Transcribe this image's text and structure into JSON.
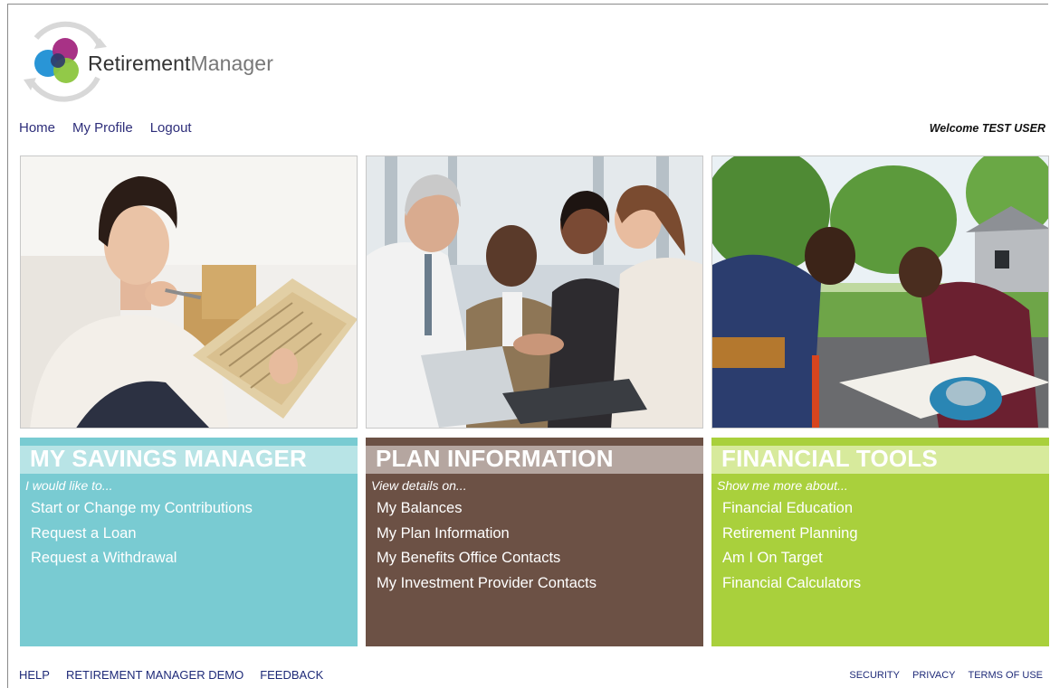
{
  "brand": {
    "name_bold": "Retirement",
    "name_light": "Manager",
    "colors": {
      "teal": "#79cbd2",
      "brown": "#6c5145",
      "green": "#a9d03c",
      "nav": "#2e2e7a"
    }
  },
  "nav": {
    "items": [
      "Home",
      "My Profile",
      "Logout"
    ],
    "welcome": "Welcome TEST USER"
  },
  "photos": [
    {
      "name": "woman-reading-newspaper-photo"
    },
    {
      "name": "business-handshake-photo"
    },
    {
      "name": "men-building-project-photo"
    }
  ],
  "cards": [
    {
      "title": "MY SAVINGS MANAGER",
      "subtitle": "I would like to...",
      "links": [
        "Start or Change my Contributions",
        "Request a Loan",
        "Request a Withdrawal"
      ]
    },
    {
      "title": "PLAN INFORMATION",
      "subtitle": "View details on...",
      "links": [
        "My Balances",
        "My Plan Information",
        "My Benefits Office Contacts",
        "My Investment Provider Contacts"
      ]
    },
    {
      "title": "FINANCIAL TOOLS",
      "subtitle": "Show me more about...",
      "links": [
        "Financial Education",
        "Retirement Planning",
        "Am I On Target",
        "Financial Calculators"
      ]
    }
  ],
  "footer": {
    "left": [
      "HELP",
      "RETIREMENT MANAGER DEMO",
      "FEEDBACK"
    ],
    "right": [
      "SECURITY",
      "PRIVACY",
      "TERMS OF USE"
    ]
  }
}
